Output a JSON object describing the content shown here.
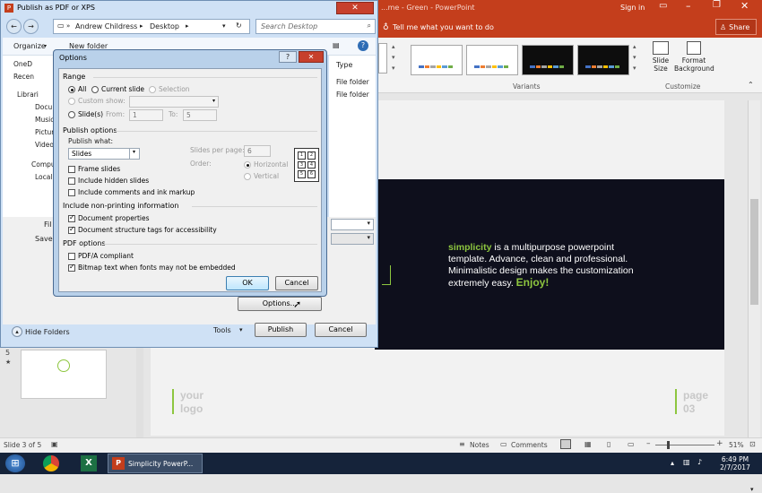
{
  "powerpoint": {
    "title_fragment": "...me - Green  -  PowerPoint",
    "sign_in": "Sign in",
    "tell_me": "Tell me what you want to do",
    "share": "Share",
    "variants_label": "Variants",
    "customize_label": "Customize",
    "slide_size": "Slide Size",
    "format_background": "Format Background",
    "slide_text": {
      "brand": "simplicity",
      "body": " is a multipurpose powerpoint template. Advance, clean and professional. Minimalistic design makes the customization extremely easy. ",
      "cta": "Enjoy!"
    },
    "footer_left": [
      "your",
      "logo"
    ],
    "footer_right": [
      "page",
      "03"
    ],
    "thumb_number": "5",
    "status": {
      "slide": "Slide 3 of 5",
      "notes": "Notes",
      "comments": "Comments",
      "zoom": "51%"
    }
  },
  "publish_dialog": {
    "title": "Publish as PDF or XPS",
    "breadcrumb": [
      "Andrew Childress",
      "Desktop"
    ],
    "search_placeholder": "Search Desktop",
    "organize": "Organize",
    "new_folder": "New folder",
    "nav_items": [
      "OneD",
      "Recen",
      "Librari",
      "Docu",
      "Music",
      "Pictur",
      "Video",
      "Compu",
      "Local"
    ],
    "column_type": "Type",
    "file_rows": [
      "File folder",
      "File folder"
    ],
    "file_name_label": "Fil",
    "save_as_label": "Save",
    "options_button": "Options...",
    "hide_folders": "Hide Folders",
    "tools": "Tools",
    "publish": "Publish",
    "cancel": "Cancel"
  },
  "options_dialog": {
    "title": "Options",
    "help": "?",
    "range": {
      "label": "Range",
      "all": "All",
      "current_slide": "Current slide",
      "selection": "Selection",
      "custom_show": "Custom show:",
      "slides": "Slide(s)",
      "from_label": "From:",
      "from_value": "1",
      "to_label": "To:",
      "to_value": "5"
    },
    "publish_options": {
      "label": "Publish options",
      "publish_what_label": "Publish what:",
      "publish_what_value": "Slides",
      "slides_per_page_label": "Slides per page:",
      "slides_per_page_value": "6",
      "order_label": "Order:",
      "horizontal": "Horizontal",
      "vertical": "Vertical",
      "frame_slides": "Frame slides",
      "hidden_slides": "Include hidden slides",
      "comments_ink": "Include comments and ink markup"
    },
    "non_printing": {
      "label": "Include non-printing information",
      "doc_properties": "Document properties",
      "structure_tags": "Document structure tags for accessibility"
    },
    "pdf_options": {
      "label": "PDF options",
      "pdfa": "PDF/A compliant",
      "bitmap_text": "Bitmap text when fonts may not be embedded"
    },
    "ok": "OK",
    "cancel": "Cancel",
    "order_grid": [
      "1",
      "2",
      "3",
      "4",
      "5",
      "6"
    ]
  },
  "taskbar": {
    "app_label": "Simplicity PowerP...",
    "time": "6:49 PM",
    "date": "2/7/2017"
  },
  "colors": {
    "ppt_red": "#c43e1c",
    "slide_green": "#8dc63f",
    "slide_dark": "#0e0f1c",
    "dialog_blue": "#cfe1f5"
  }
}
